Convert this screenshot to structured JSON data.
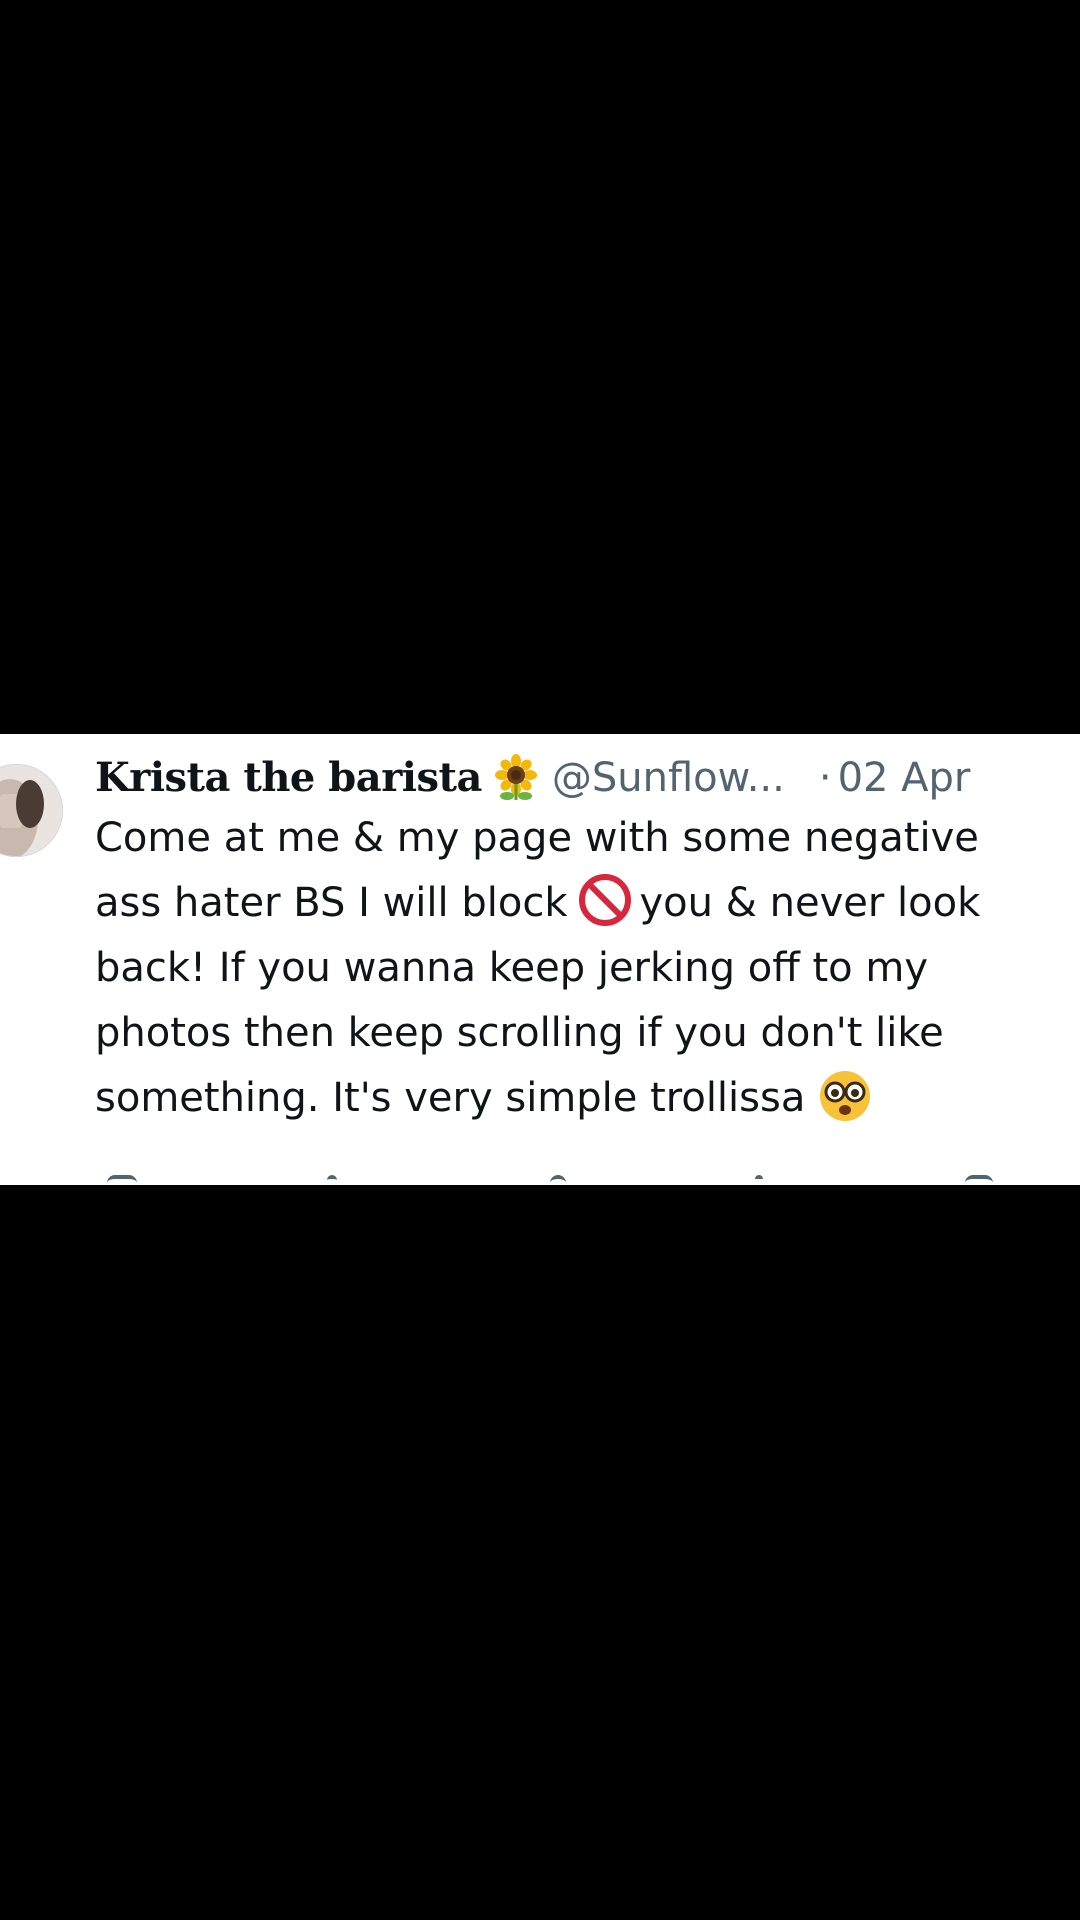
{
  "tweet": {
    "display_name": "Krista the barista",
    "name_emoji": "sunflower-icon",
    "handle": "@Sunflow...",
    "separator": "·",
    "date": "02 Apr",
    "text_lines": [
      "Come at me & my page with some negative",
      "ass hater BS I will block",
      "you & never look",
      "back! If you wanna keep jerking off to my",
      "photos then keep scrolling if you don't like",
      "something.  It's very simple trollissa"
    ],
    "inline_icons": [
      "prohibited-icon",
      "face-with-monocle-glasses-icon"
    ],
    "actions": [
      "reply-icon",
      "retweet-icon",
      "like-icon",
      "views-icon",
      "share-icon"
    ]
  },
  "colors": {
    "background": "#000000",
    "card": "#ffffff",
    "text": "#0f1419",
    "secondary": "#536471",
    "prohibited": "#d7263d"
  }
}
